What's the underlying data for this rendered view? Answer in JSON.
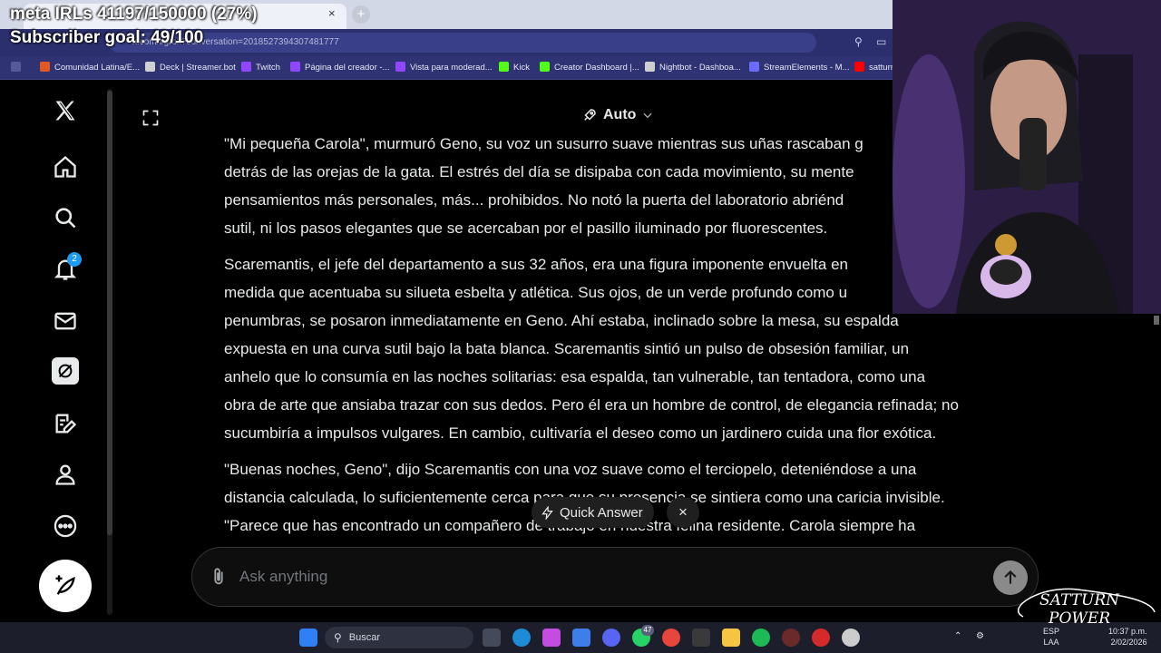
{
  "overlay": {
    "meta_line": "meta IRLs 41197/150000 (27%)",
    "subscriber_line": "Subscriber goal: 49/100"
  },
  "browser": {
    "url": "x.com/i/grok?conversation=2018527394307481777",
    "tab_close": "×",
    "new_tab": "+",
    "bookmarks": [
      "Comunidad Latina/E...",
      "Deck | Streamer.bot",
      "Twitch",
      "Página del creador -...",
      "Vista para moderad...",
      "Kick",
      "Creator Dashboard |...",
      "Nightbot - Dashboa...",
      "StreamElements - M...",
      "satturn"
    ]
  },
  "sidebar": {
    "notifications_count": "2",
    "items": [
      "x-logo",
      "home",
      "explore",
      "notifications",
      "messages",
      "grok",
      "drafts",
      "profile",
      "more"
    ]
  },
  "header": {
    "model_label": "Auto"
  },
  "article": {
    "paragraphs": [
      "\"Mi pequeña Carola\", murmuró Geno, su voz un susurro suave mientras sus uñas rascaban g\ndetrás de las orejas de la gata. El estrés del día se disipaba con cada movimiento, su mente\npensamientos más personales, más... prohibidos. No notó la puerta del laboratorio abriénd\nsutil, ni los pasos elegantes que se acercaban por el pasillo iluminado por fluorescentes.",
      "Scaremantis, el jefe del departamento a sus 32 años, era una figura imponente envuelta en\nmedida que acentuaba su silueta esbelta y atlética. Sus ojos, de un verde profundo como u\npenumbras, se posaron inmediatamente en Geno. Ahí estaba, inclinado sobre la mesa, su espalda\nexpuesta en una curva sutil bajo la bata blanca. Scaremantis sintió un pulso de obsesión familiar, un\nanhelo que lo consumía en las noches solitarias: esa espalda, tan vulnerable, tan tentadora, como una\nobra de arte que ansiaba trazar con sus dedos. Pero él era un hombre de control, de elegancia refinada; no\nsucumbiría a impulsos vulgares. En cambio, cultivaría el deseo como un jardinero cuida una flor exótica.",
      "\"Buenas noches, Geno\", dijo Scaremantis con una voz suave como el terciopelo, deteniéndose a una\ndistancia calculada, lo suficientemente cerca para que su presencia se sintiera como una caricia invisible.\n\"Parece que has encontrado un compañero de trabajo en nuestra felina residente. Carola siempre ha"
    ]
  },
  "quick_answer": {
    "label": "Quick Answer",
    "close": "×"
  },
  "composer": {
    "placeholder": "Ask anything"
  },
  "taskbar": {
    "search_label": "Buscar",
    "badge": "47",
    "lang_top": "ESP",
    "lang_bottom": "LAA",
    "time": "10:37 p.m.",
    "date": "2/02/2026"
  },
  "logo_text_top": "SATTURN",
  "logo_text_bottom": "POWER",
  "colors": {
    "accent": "#1d9bf0",
    "background": "#000000",
    "text": "#e7e9ea",
    "muted": "#71767b"
  }
}
